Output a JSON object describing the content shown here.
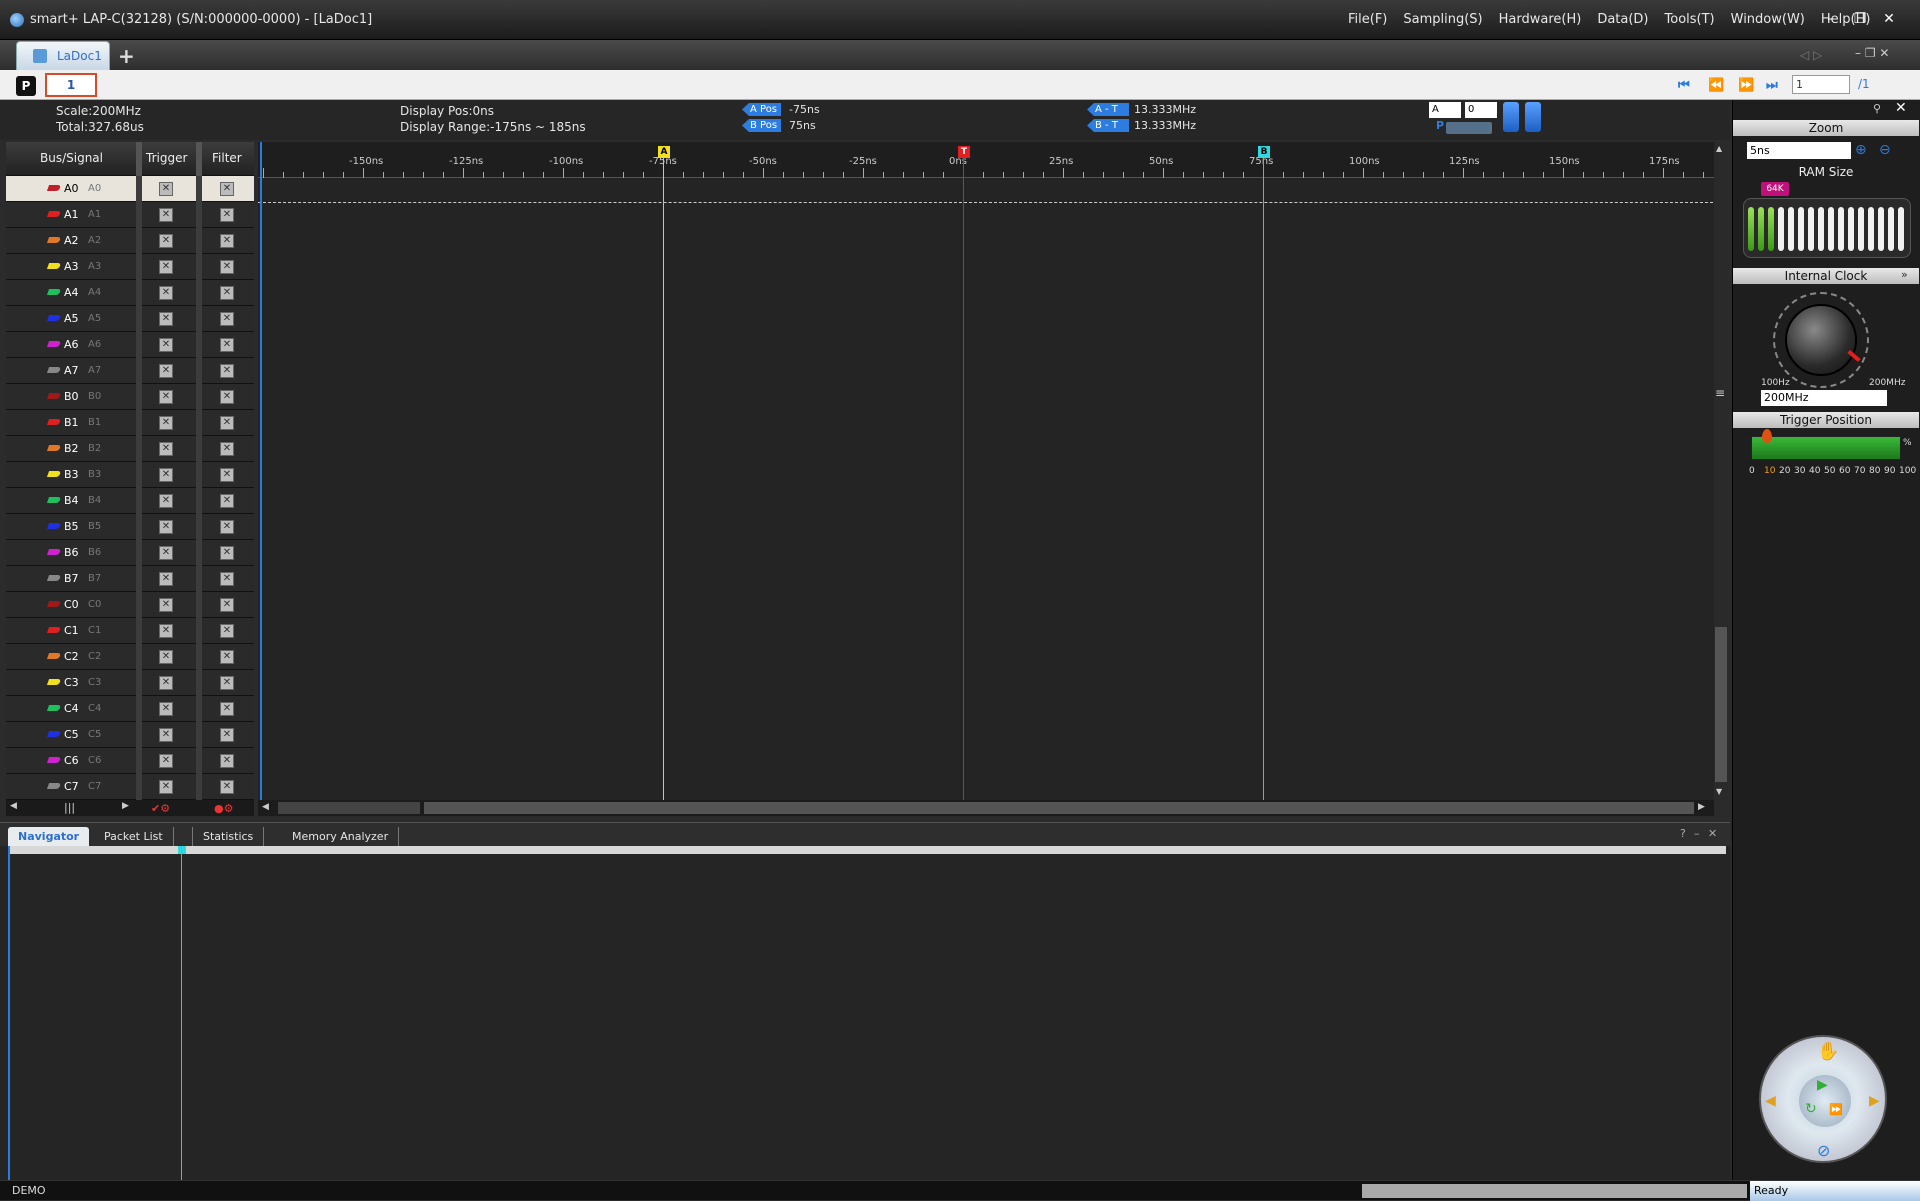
{
  "window": {
    "title": "smart+  LAP-C(32128) (S/N:000000-0000) - [LaDoc1]",
    "menus": [
      "File(F)",
      "Sampling(S)",
      "Hardware(H)",
      "Data(D)",
      "Tools(T)",
      "Window(W)",
      "Help(H)"
    ],
    "buttons": {
      "minimize": "–",
      "restore": "❐",
      "close": "✕"
    }
  },
  "doc_tab": {
    "label": "LaDoc1",
    "add": "+"
  },
  "page_bar": {
    "p_badge": "P",
    "page_value": "1",
    "page_input": "1",
    "page_total": "/1"
  },
  "info": {
    "scale": "Scale:200MHz",
    "total": "Total:327.68us",
    "display_pos": "Display Pos:0ns",
    "display_range": "Display Range:-175ns ~ 185ns",
    "a_pos_tag": "A Pos",
    "a_pos_val": "-75ns",
    "b_pos_tag": "B Pos",
    "b_pos_val": "75ns",
    "a_t_tag": "A - T",
    "a_t_val": "13.333MHz",
    "b_t_tag": "B - T",
    "b_t_val": "13.333MHz",
    "sel_a": "A",
    "sel_0": "0",
    "p_label": "P"
  },
  "grid_header": {
    "bus_signal": "Bus/Signal",
    "trigger": "Trigger",
    "filter": "Filter"
  },
  "channels": [
    {
      "name": "A0",
      "sub": "A0",
      "color": "#c0202a"
    },
    {
      "name": "A1",
      "sub": "A1",
      "color": "#e02020"
    },
    {
      "name": "A2",
      "sub": "A2",
      "color": "#e07828"
    },
    {
      "name": "A3",
      "sub": "A3",
      "color": "#f0e020"
    },
    {
      "name": "A4",
      "sub": "A4",
      "color": "#20c060"
    },
    {
      "name": "A5",
      "sub": "A5",
      "color": "#2030e0"
    },
    {
      "name": "A6",
      "sub": "A6",
      "color": "#d020d0"
    },
    {
      "name": "A7",
      "sub": "A7",
      "color": "#888888"
    },
    {
      "name": "B0",
      "sub": "B0",
      "color": "#a01818"
    },
    {
      "name": "B1",
      "sub": "B1",
      "color": "#e02020"
    },
    {
      "name": "B2",
      "sub": "B2",
      "color": "#e07828"
    },
    {
      "name": "B3",
      "sub": "B3",
      "color": "#f0e020"
    },
    {
      "name": "B4",
      "sub": "B4",
      "color": "#20c060"
    },
    {
      "name": "B5",
      "sub": "B5",
      "color": "#2030e0"
    },
    {
      "name": "B6",
      "sub": "B6",
      "color": "#d020d0"
    },
    {
      "name": "B7",
      "sub": "B7",
      "color": "#888888"
    },
    {
      "name": "C0",
      "sub": "C0",
      "color": "#a01818"
    },
    {
      "name": "C1",
      "sub": "C1",
      "color": "#e02020"
    },
    {
      "name": "C2",
      "sub": "C2",
      "color": "#e07828"
    },
    {
      "name": "C3",
      "sub": "C3",
      "color": "#f0e020"
    },
    {
      "name": "C4",
      "sub": "C4",
      "color": "#20c060"
    },
    {
      "name": "C5",
      "sub": "C5",
      "color": "#2030e0"
    },
    {
      "name": "C6",
      "sub": "C6",
      "color": "#d020d0"
    },
    {
      "name": "C7",
      "sub": "C7",
      "color": "#888888"
    }
  ],
  "ruler": {
    "ticks": [
      "-150ns",
      "-125ns",
      "-100ns",
      "-75ns",
      "-50ns",
      "-25ns",
      "0ns",
      "25ns",
      "50ns",
      "75ns",
      "100ns",
      "125ns",
      "150ns",
      "175ns"
    ],
    "markers": {
      "a": "A",
      "t": "T",
      "b": "B"
    }
  },
  "right_panel": {
    "zoom_title": "Zoom",
    "zoom_value": "5ns",
    "ram_title": "RAM Size",
    "ram_badge": "64K",
    "clock_title": "Internal Clock",
    "clock_min": "100Hz",
    "clock_max": "200MHz",
    "clock_value": "200MHz",
    "trigger_title": "Trigger Position",
    "trigger_pct": "%",
    "trigger_scale": [
      "0",
      "10",
      "20",
      "30",
      "40",
      "50",
      "60",
      "70",
      "80",
      "90",
      "100"
    ],
    "trigger_value": 10
  },
  "bottom_tabs": [
    "Navigator",
    "Packet List",
    "Statistics",
    "Memory Analyzer"
  ],
  "bottom_controls": {
    "help": "?",
    "minimize": "–",
    "close": "✕"
  },
  "status": {
    "left": "DEMO",
    "right": "Ready"
  }
}
